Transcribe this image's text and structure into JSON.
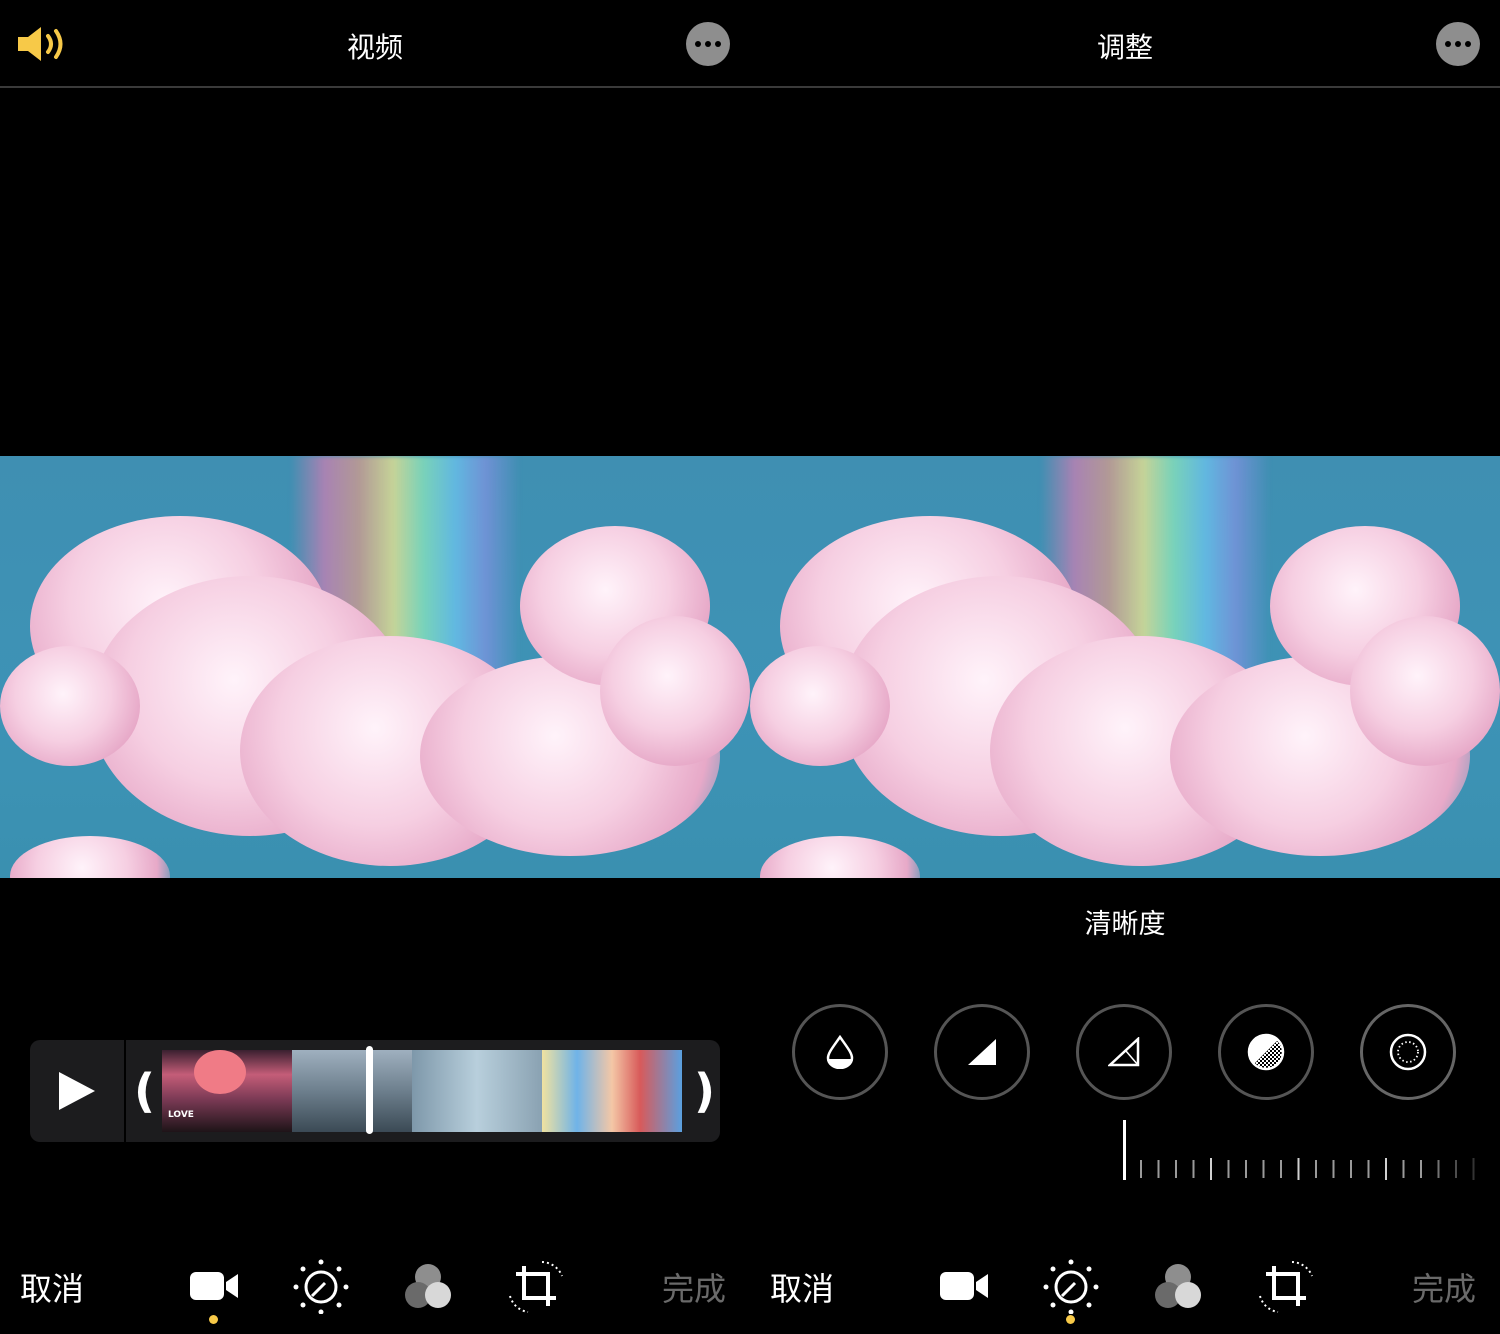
{
  "left": {
    "title": "视频",
    "cancel_label": "取消",
    "done_label": "完成",
    "thumb_text": "LOVE"
  },
  "right": {
    "title": "调整",
    "adjustment_label": "清晰度",
    "cancel_label": "取消",
    "done_label": "完成"
  },
  "icons": {
    "speaker": "speaker-icon",
    "more": "more-icon",
    "video": "video-camera-icon",
    "adjust": "adjust-dial-icon",
    "filters": "filters-icon",
    "crop": "crop-rotate-icon",
    "play": "play-icon"
  },
  "colors": {
    "accent": "#f7c948",
    "muted_text": "#6a6a6a",
    "sky": "#3d93b6"
  },
  "adjust_tools": [
    "vibrance",
    "warmth",
    "tint",
    "sharpness",
    "definition"
  ]
}
